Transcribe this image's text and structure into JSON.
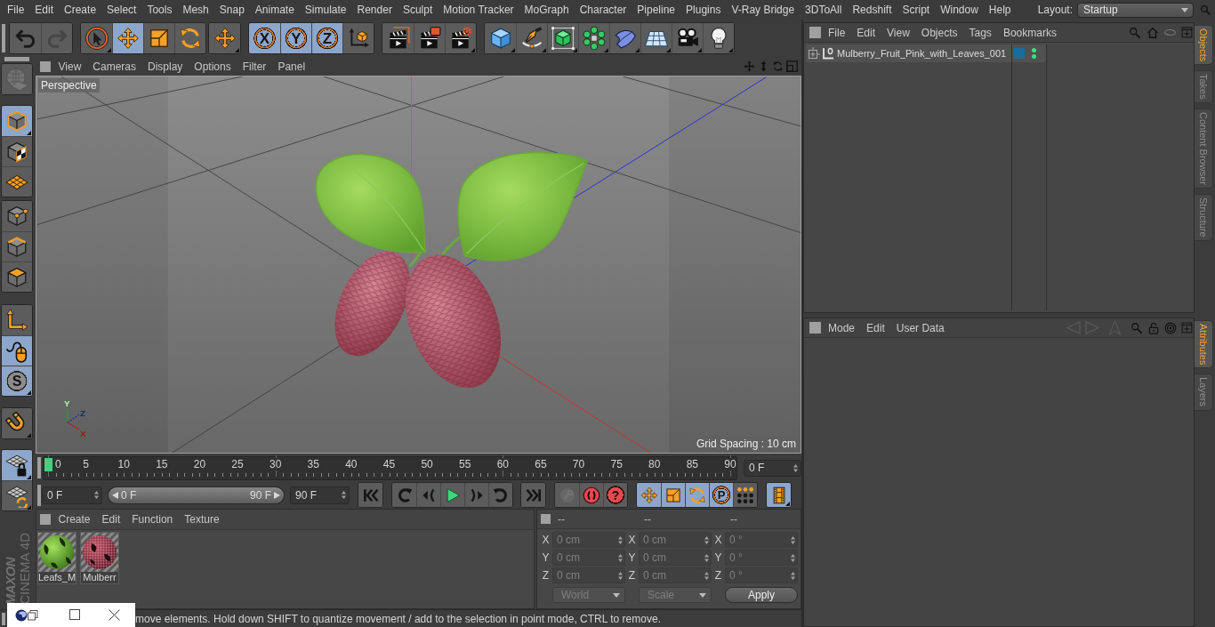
{
  "menubar": {
    "items": [
      "File",
      "Edit",
      "Create",
      "Select",
      "Tools",
      "Mesh",
      "Snap",
      "Animate",
      "Simulate",
      "Render",
      "Sculpt",
      "Motion Tracker",
      "MoGraph",
      "Character",
      "Pipeline",
      "Plugins",
      "V-Ray Bridge",
      "3DToAll",
      "Redshift",
      "Script",
      "Window",
      "Help"
    ],
    "layout_label": "Layout:",
    "layout_value": "Startup"
  },
  "toolbar": {
    "groups": [
      {
        "items": [
          {
            "kind": "undo",
            "selected": false,
            "disabled": false,
            "flyout": false
          },
          {
            "kind": "redo",
            "selected": false,
            "disabled": true,
            "flyout": false
          }
        ]
      },
      {
        "items": [
          {
            "kind": "live_select",
            "selected": false,
            "disabled": false,
            "flyout": true
          },
          {
            "kind": "move",
            "selected": true,
            "disabled": false,
            "flyout": false
          },
          {
            "kind": "scale",
            "selected": false,
            "disabled": false,
            "flyout": false
          },
          {
            "kind": "rotate",
            "selected": false,
            "disabled": false,
            "flyout": false
          }
        ]
      },
      {
        "items": [
          {
            "kind": "recent",
            "selected": false,
            "disabled": false,
            "flyout": true
          }
        ]
      },
      {
        "items": [
          {
            "kind": "axis_lock",
            "label": "X",
            "selected": true,
            "disabled": false,
            "flyout": false
          },
          {
            "kind": "axis_lock",
            "label": "Y",
            "selected": true,
            "disabled": false,
            "flyout": false
          },
          {
            "kind": "axis_lock",
            "label": "Z",
            "selected": true,
            "disabled": false,
            "flyout": false
          },
          {
            "kind": "coord_system",
            "selected": false,
            "disabled": false,
            "flyout": false
          }
        ]
      },
      {
        "items": [
          {
            "kind": "render_view",
            "selected": false,
            "disabled": false,
            "flyout": false
          },
          {
            "kind": "render_pv",
            "selected": false,
            "disabled": false,
            "flyout": false
          },
          {
            "kind": "render_settings",
            "selected": false,
            "disabled": false,
            "flyout": true
          }
        ]
      },
      {
        "items": [
          {
            "kind": "cube",
            "selected": false,
            "disabled": false,
            "flyout": true
          },
          {
            "kind": "pen",
            "selected": false,
            "disabled": false,
            "flyout": true
          },
          {
            "kind": "subdivision",
            "selected": false,
            "disabled": false,
            "flyout": true
          },
          {
            "kind": "cloner",
            "selected": false,
            "disabled": false,
            "flyout": true
          },
          {
            "kind": "deformer",
            "selected": false,
            "disabled": false,
            "flyout": true
          },
          {
            "kind": "floor",
            "selected": false,
            "disabled": false,
            "flyout": true
          },
          {
            "kind": "camera",
            "selected": false,
            "disabled": false,
            "flyout": true
          },
          {
            "kind": "light",
            "selected": false,
            "disabled": false,
            "flyout": true
          }
        ]
      }
    ]
  },
  "left_toolbar": {
    "groups": [
      {
        "items": [
          {
            "kind": "make_editable",
            "selected": false,
            "disabled": true,
            "flyout": false
          }
        ]
      },
      {
        "items": [
          {
            "kind": "model",
            "selected": true,
            "disabled": false,
            "flyout": true
          },
          {
            "kind": "texture",
            "selected": false,
            "disabled": false,
            "flyout": false
          },
          {
            "kind": "workplane",
            "selected": false,
            "disabled": false,
            "flyout": false
          }
        ]
      },
      {
        "items": [
          {
            "kind": "points",
            "selected": false,
            "disabled": false,
            "flyout": false
          },
          {
            "kind": "edges",
            "selected": false,
            "disabled": false,
            "flyout": false
          },
          {
            "kind": "polygons",
            "selected": false,
            "disabled": false,
            "flyout": false
          }
        ]
      },
      {
        "items": [
          {
            "kind": "axis",
            "selected": false,
            "disabled": false,
            "flyout": false
          },
          {
            "kind": "tweak",
            "selected": true,
            "disabled": false,
            "flyout": false
          },
          {
            "kind": "snap",
            "label": "S",
            "selected": true,
            "disabled": false,
            "flyout": true
          }
        ]
      },
      {
        "items": [
          {
            "kind": "magnet",
            "selected": false,
            "disabled": false,
            "flyout": true
          }
        ]
      },
      {
        "items": [
          {
            "kind": "grid_lock",
            "selected": true,
            "disabled": false,
            "flyout": true
          },
          {
            "kind": "grid_rotate",
            "selected": false,
            "disabled": false,
            "flyout": true
          }
        ]
      }
    ]
  },
  "logo": {
    "lines": [
      "MAXON",
      "CINEMA 4D"
    ]
  },
  "viewport": {
    "menu": [
      "View",
      "Cameras",
      "Display",
      "Options",
      "Filter",
      "Panel"
    ],
    "camera": "Perspective",
    "grid_spacing": "Grid Spacing : 10 cm",
    "axis_labels": [
      "Y",
      "Z",
      "X"
    ]
  },
  "timeline": {
    "ticks": [
      "0",
      "5",
      "10",
      "15",
      "20",
      "25",
      "30",
      "35",
      "40",
      "45",
      "50",
      "55",
      "60",
      "65",
      "70",
      "75",
      "80",
      "85",
      "90"
    ],
    "level": 0,
    "current_frame": "0 F"
  },
  "transport": {
    "start_frame": "0 F",
    "range": {
      "start": "0 F",
      "end": "90 F",
      "level": 1
    },
    "end_frame": "90 F",
    "groups": [
      {
        "items": [
          {
            "kind": "go_start",
            "selected": false,
            "disabled": false,
            "flyout": false
          }
        ]
      },
      {
        "items": [
          {
            "kind": "prev_key",
            "selected": false,
            "disabled": false,
            "flyout": false
          },
          {
            "kind": "prev_frame",
            "selected": false,
            "disabled": false,
            "flyout": false
          },
          {
            "kind": "play",
            "selected": false,
            "disabled": false,
            "flyout": false
          },
          {
            "kind": "next_frame",
            "selected": false,
            "disabled": false,
            "flyout": false
          },
          {
            "kind": "next_key",
            "selected": false,
            "disabled": false,
            "flyout": false
          }
        ]
      },
      {
        "items": [
          {
            "kind": "go_end",
            "selected": false,
            "disabled": false,
            "flyout": false
          }
        ]
      },
      {
        "items": [
          {
            "kind": "record",
            "selected": false,
            "disabled": true,
            "flyout": false
          },
          {
            "kind": "autokey",
            "selected": false,
            "disabled": false,
            "flyout": false
          },
          {
            "kind": "key_selection",
            "label": "?",
            "selected": false,
            "disabled": false,
            "flyout": false
          }
        ]
      },
      {
        "items": [
          {
            "kind": "track_position",
            "selected": true,
            "disabled": false,
            "flyout": false
          },
          {
            "kind": "track_scale",
            "selected": true,
            "disabled": false,
            "flyout": false
          },
          {
            "kind": "track_rotation",
            "selected": true,
            "disabled": false,
            "flyout": false
          },
          {
            "kind": "track_parameter",
            "label": "P",
            "selected": true,
            "disabled": false,
            "flyout": false
          },
          {
            "kind": "track_points",
            "selected": false,
            "disabled": false,
            "flyout": false
          }
        ]
      },
      {
        "items": [
          {
            "kind": "timeline",
            "selected": true,
            "disabled": false,
            "flyout": true
          }
        ]
      }
    ]
  },
  "materials": {
    "menu": [
      "Create",
      "Edit",
      "Function",
      "Texture"
    ],
    "items": [
      {
        "name": "Leafs_M",
        "kind": "leaf",
        "selected": false
      },
      {
        "name": "Mulberr",
        "kind": "berry",
        "selected": false
      }
    ]
  },
  "coordinates": {
    "headers": [
      "--",
      "--",
      "--"
    ],
    "disabled": true,
    "rows": [
      {
        "cells": [
          {
            "label": "X",
            "value": "0 cm"
          },
          {
            "label": "X",
            "value": "0 cm"
          },
          {
            "label": "X",
            "value": "0 °"
          }
        ]
      },
      {
        "cells": [
          {
            "label": "Y",
            "value": "0 cm"
          },
          {
            "label": "Y",
            "value": "0 cm"
          },
          {
            "label": "Y",
            "value": "0 °"
          }
        ]
      },
      {
        "cells": [
          {
            "label": "Z",
            "value": "0 cm"
          },
          {
            "label": "Z",
            "value": "0 cm"
          },
          {
            "label": "Z",
            "value": "0 °"
          }
        ]
      }
    ],
    "dropdowns": [
      "World",
      "Scale"
    ],
    "apply": "Apply"
  },
  "status_bar": {
    "text": "move elements. Hold down SHIFT to quantize movement / add to the selection in point mode, CTRL to remove."
  },
  "objects": {
    "menu": [
      "File",
      "Edit",
      "View",
      "Objects",
      "Tags",
      "Bookmarks"
    ],
    "items": [
      {
        "name": "Mulberry_Fruit_Pink_with_Leaves_001",
        "expanded": false,
        "selected": false,
        "color": "#1b6b9b",
        "editor_visible": true,
        "render_visible": true
      }
    ]
  },
  "objects_tabs": [
    {
      "label": "Objects",
      "selected": true
    },
    {
      "label": "Takes",
      "selected": false
    },
    {
      "label": "Content Browser",
      "selected": false
    },
    {
      "label": "Structure",
      "selected": false
    }
  ],
  "attributes": {
    "menu": [
      "Mode",
      "Edit",
      "User Data"
    ],
    "nav_disabled": true
  },
  "attributes_tabs": [
    {
      "label": "Attributes",
      "selected": true
    },
    {
      "label": "Layers",
      "selected": false
    }
  ]
}
